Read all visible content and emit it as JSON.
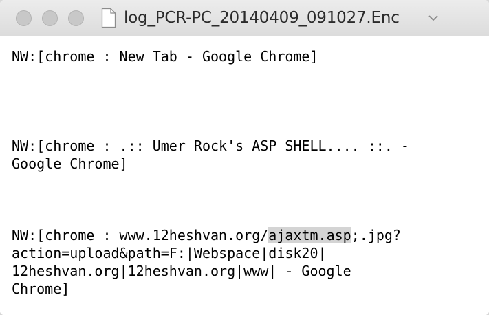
{
  "window": {
    "title": "log_PCR-PC_20140409_091027.Enc"
  },
  "log": {
    "entry1": {
      "line1": "NW:[chrome : New Tab - Google Chrome]"
    },
    "entry2": {
      "line1": "NW:[chrome : .:: Umer Rock's ASP SHELL.... ::. -",
      "line2": "Google Chrome]"
    },
    "entry3": {
      "line1_pre": "NW:[chrome : www.12heshvan.org/",
      "line1_highlight": "ajaxtm.asp",
      "line1_post": ";.jpg?",
      "line2": "action=upload&path=F:|Webspace|disk20|",
      "line3": "12heshvan.org|12heshvan.org|www| - Google",
      "line4": "Chrome]"
    }
  },
  "colors": {
    "highlight": "#d4d4d4",
    "titlebar": "#e5e5e5"
  }
}
